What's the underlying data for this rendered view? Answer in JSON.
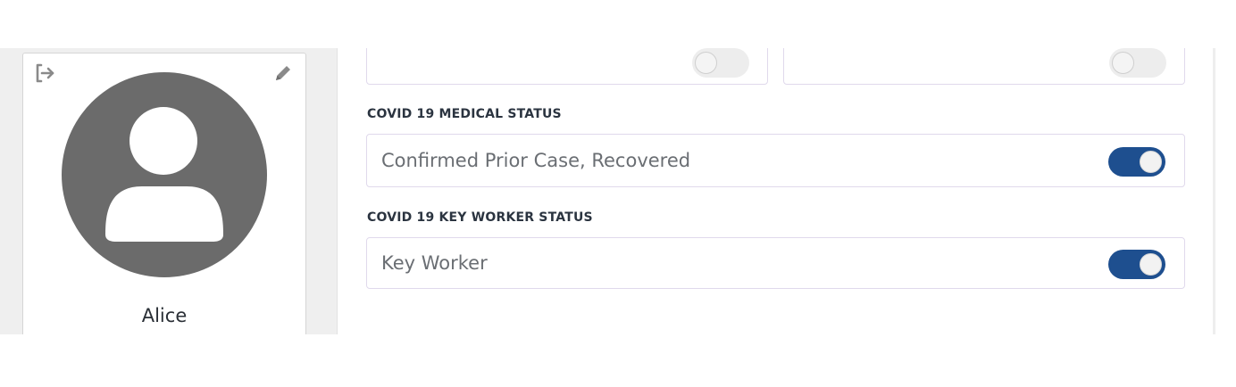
{
  "profile": {
    "name": "Alice",
    "logout_icon": "logout-icon",
    "edit_icon": "pencil-icon",
    "avatar_icon": "user-silhouette-icon"
  },
  "fields": {
    "top_left": {
      "value": "",
      "enabled": false
    },
    "top_right": {
      "value": "",
      "enabled": false
    },
    "medical_status": {
      "label": "COVID 19 MEDICAL STATUS",
      "value": "Confirmed Prior Case, Recovered",
      "enabled": true
    },
    "key_worker_status": {
      "label": "COVID 19 KEY WORKER STATUS",
      "value": "Key Worker",
      "enabled": true
    }
  },
  "colors": {
    "toggle_on": "#1e4f8f",
    "field_border": "#e0d9ec",
    "avatar": "#6b6b6b"
  }
}
